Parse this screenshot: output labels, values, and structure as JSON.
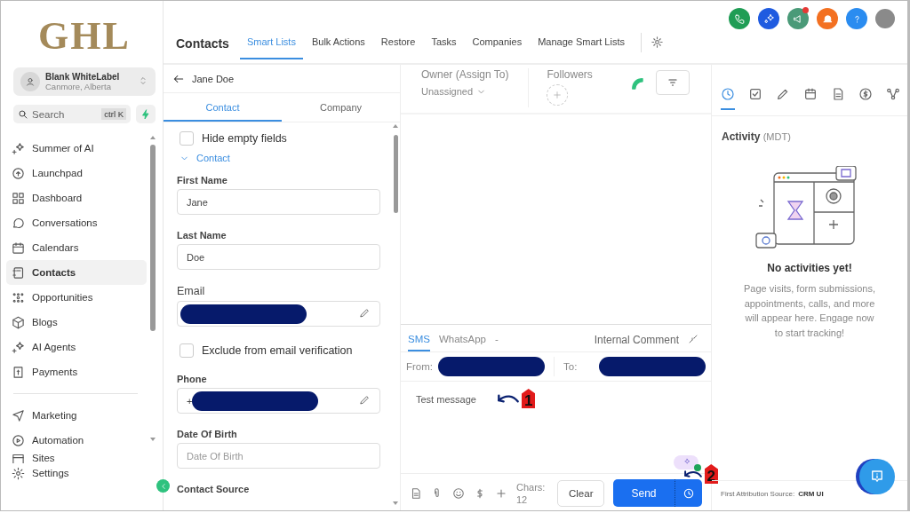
{
  "sidebar": {
    "logo": "GHL",
    "account": {
      "name": "Blank WhiteLabel",
      "location": "Canmore, Alberta"
    },
    "search": {
      "placeholder": "Search",
      "shortcut": "ctrl K"
    },
    "nav": [
      {
        "label": "Summer of AI",
        "selected": false
      },
      {
        "label": "Launchpad",
        "selected": false
      },
      {
        "label": "Dashboard",
        "selected": false
      },
      {
        "label": "Conversations",
        "selected": false
      },
      {
        "label": "Calendars",
        "selected": false
      },
      {
        "label": "Contacts",
        "selected": true
      },
      {
        "label": "Opportunities",
        "selected": false
      },
      {
        "label": "Blogs",
        "selected": false
      },
      {
        "label": "AI Agents",
        "selected": false
      },
      {
        "label": "Payments",
        "selected": false
      }
    ],
    "nav_secondary": [
      {
        "label": "Marketing",
        "selected": false
      },
      {
        "label": "Automation",
        "selected": false
      },
      {
        "label": "Sites",
        "selected": false
      }
    ],
    "settings": "Settings"
  },
  "header": {
    "title": "Contacts",
    "tabs": [
      {
        "label": "Smart Lists",
        "selected": true
      },
      {
        "label": "Bulk Actions",
        "selected": false
      },
      {
        "label": "Restore",
        "selected": false
      },
      {
        "label": "Tasks",
        "selected": false
      },
      {
        "label": "Companies",
        "selected": false
      },
      {
        "label": "Manage Smart Lists",
        "selected": false
      }
    ],
    "notification_dot": true
  },
  "contact_panel": {
    "name": "Jane Doe",
    "tabs": [
      {
        "label": "Contact",
        "selected": true
      },
      {
        "label": "Company",
        "selected": false
      }
    ],
    "hide_empty": {
      "label": "Hide empty fields",
      "checked": false
    },
    "section": {
      "label": "Contact",
      "expanded": true
    },
    "fields": [
      {
        "kind": "text",
        "label": "First Name",
        "value": "Jane"
      },
      {
        "kind": "text",
        "label": "Last Name",
        "value": "Doe"
      },
      {
        "kind": "redacted",
        "label": "Email"
      },
      {
        "kind": "checkbox",
        "label": "Exclude from email verification",
        "checked": false
      },
      {
        "kind": "phone",
        "label": "Phone",
        "value": "+"
      },
      {
        "kind": "placeholder",
        "label": "Date Of Birth",
        "placeholder": "Date Of Birth"
      },
      {
        "kind": "heading",
        "label": "Contact Source"
      }
    ]
  },
  "conversation": {
    "owner_label": "Owner (Assign To)",
    "owner_value": "Unassigned",
    "followers_label": "Followers",
    "channels": [
      {
        "label": "SMS",
        "selected": true
      },
      {
        "label": "WhatsApp",
        "selected": false
      },
      {
        "label": "-",
        "selected": false
      }
    ],
    "internal_comment": "Internal Comment",
    "from_label": "From:",
    "to_label": "To:",
    "message": "Test message",
    "ai_toggle": {
      "on": true
    },
    "chars": "Chars: 12",
    "clear": "Clear",
    "send": "Send",
    "annotations": [
      "1",
      "2"
    ]
  },
  "activity": {
    "tabs": [
      {
        "selected": true
      },
      {
        "selected": false
      },
      {
        "selected": false
      },
      {
        "selected": false
      },
      {
        "selected": false
      },
      {
        "selected": false
      },
      {
        "selected": false
      }
    ],
    "title": "Activity",
    "timezone": "(MDT)",
    "empty_title": "No activities yet!",
    "empty_text": "Page visits, form submissions, appointments, calls, and more will appear here. Engage now to start tracking!",
    "attribution_label": "First Attribution Source:",
    "attribution_value": "CRM UI"
  }
}
